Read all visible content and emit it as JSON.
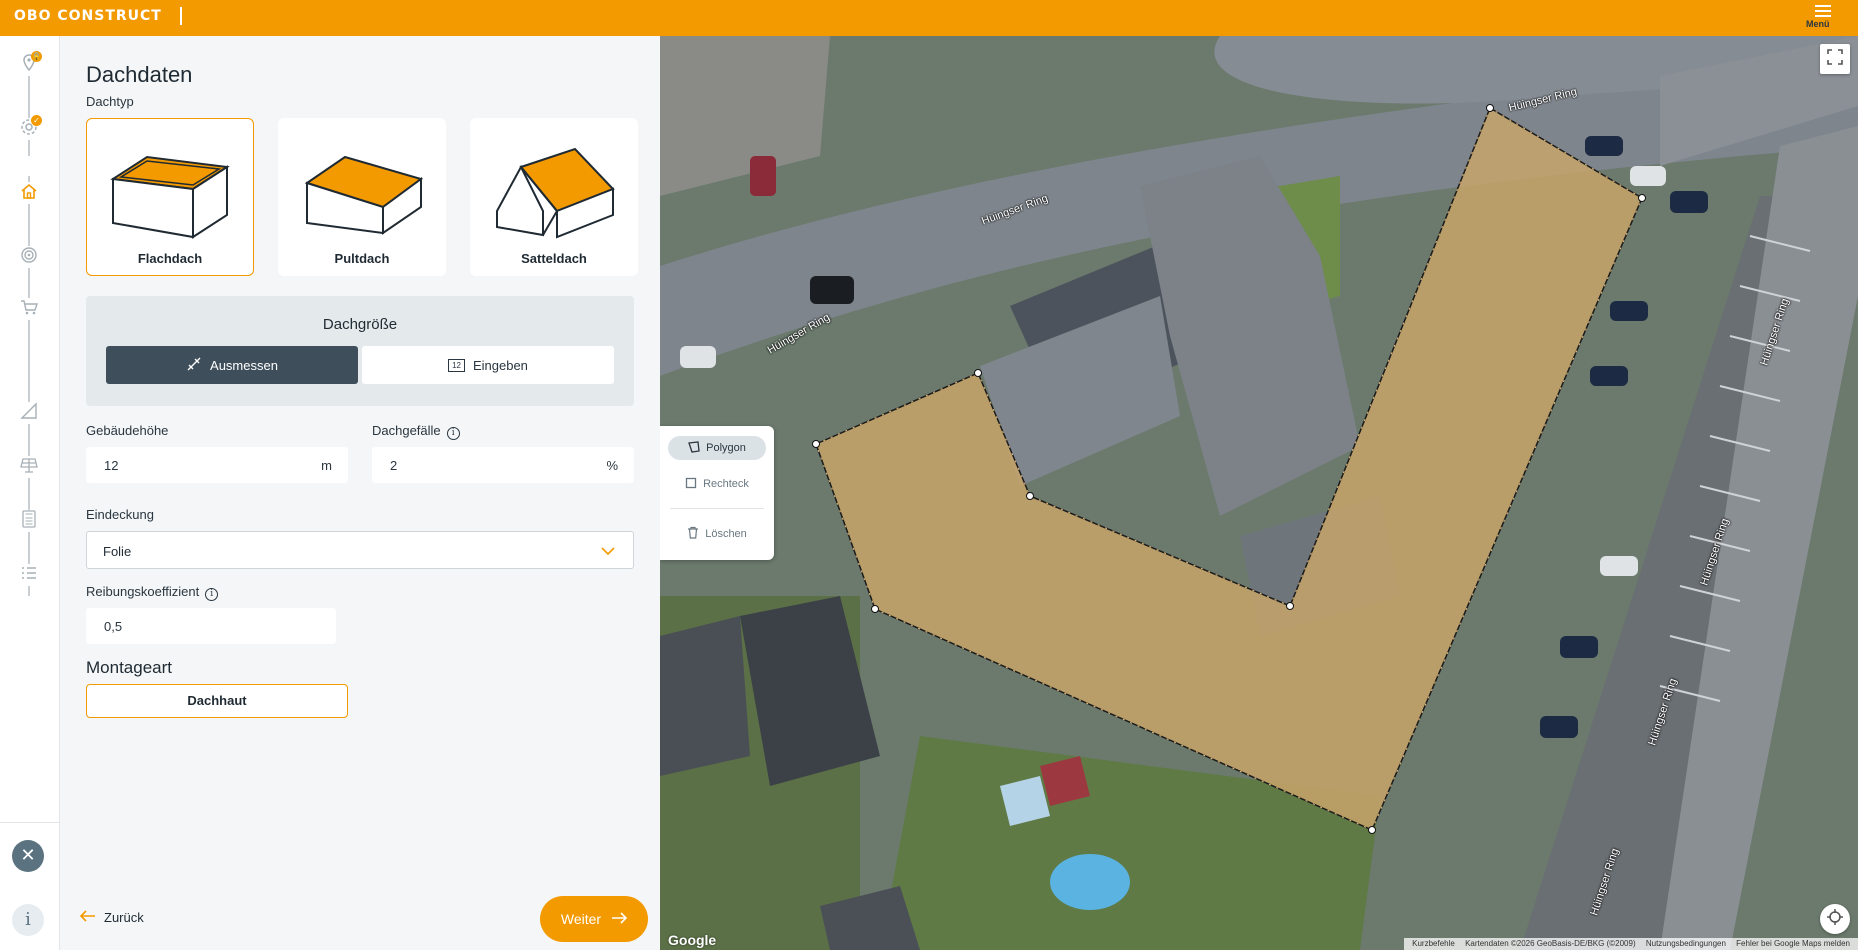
{
  "app": {
    "logo": "OBO CONSTRUCT",
    "menu_label": "Menü"
  },
  "panel": {
    "title": "Dachdaten",
    "roof_type_label": "Dachtyp",
    "roof_types": [
      {
        "name": "Flachdach",
        "selected": true
      },
      {
        "name": "Pultdach",
        "selected": false
      },
      {
        "name": "Satteldach",
        "selected": false
      }
    ],
    "size": {
      "title": "Dachgröße",
      "measure_label": "Ausmessen",
      "enter_label": "Eingeben",
      "enter_icon_text": "12"
    },
    "building_height": {
      "label": "Gebäudehöhe",
      "value": "12",
      "unit": "m"
    },
    "roof_slope": {
      "label": "Dachgefälle",
      "value": "2",
      "unit": "%"
    },
    "covering": {
      "label": "Eindeckung",
      "value": "Folie"
    },
    "friction": {
      "label": "Reibungskoeffizient",
      "value": "0,5"
    },
    "mounting": {
      "label": "Montageart",
      "value": "Dachhaut"
    },
    "back_label": "Zurück",
    "next_label": "Weiter"
  },
  "map": {
    "tools": {
      "polygon": "Polygon",
      "rectangle": "Rechteck",
      "delete": "Löschen"
    },
    "streets": [
      "Hüingser Ring",
      "Hüingser Ring",
      "Hüingser Ring",
      "Hüingser Ring",
      "Hüingser Ring",
      "Hüingser Ring",
      "Hüingser Ring"
    ],
    "google_logo": "Google",
    "attribution": {
      "shortcuts": "Kurzbefehle",
      "data": "Kartendaten ©2026 GeoBasis-DE/BKG (©2009)",
      "terms": "Nutzungsbedingungen",
      "report": "Fehler bei Google Maps melden"
    }
  },
  "colors": {
    "accent": "#f39a00",
    "dark": "#3e4f5b",
    "roof_overlay": "#c8a56a"
  }
}
